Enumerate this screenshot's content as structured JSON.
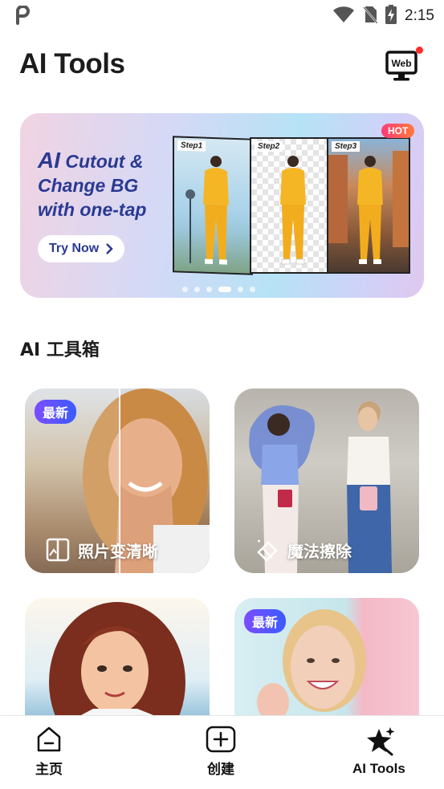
{
  "status_bar": {
    "time": "2:15"
  },
  "header": {
    "title": "AI Tools",
    "web_button_label": "Web"
  },
  "banner": {
    "headline_ai": "AI",
    "headline_rest_line1": "Cutout &",
    "headline_line2": "Change BG",
    "headline_line3": "with one-tap",
    "cta_label": "Try Now",
    "badge": "HOT",
    "steps": [
      "Step1",
      "Step2",
      "Step3"
    ],
    "page_count": 6,
    "active_page": 4
  },
  "section": {
    "title": "AI 工具箱"
  },
  "tools": [
    {
      "label": "照片变清晰",
      "badge": "最新",
      "icon": "enhance-icon"
    },
    {
      "label": "魔法擦除",
      "badge": "",
      "icon": "eraser-icon"
    },
    {
      "label": "",
      "badge": "",
      "icon": ""
    },
    {
      "label": "",
      "badge": "最新",
      "icon": ""
    }
  ],
  "bottom_nav": {
    "items": [
      {
        "label": "主页",
        "icon": "home-icon"
      },
      {
        "label": "创建",
        "icon": "add-box-icon"
      },
      {
        "label": "AI Tools",
        "icon": "ai-star-icon"
      }
    ]
  }
}
